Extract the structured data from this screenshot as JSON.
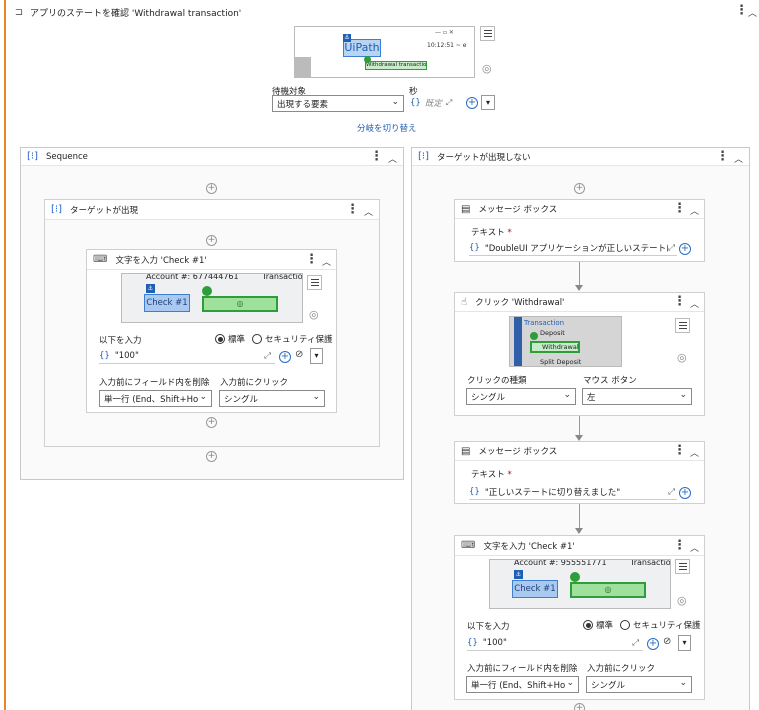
{
  "main": {
    "title": "アプリのステートを確認 'Withdrawal transaction'",
    "wait_label": "待機対象",
    "wait_value": "出現する要素",
    "seconds_label": "秒",
    "seconds_placeholder": "既定",
    "switch_link": "分岐を切り替え",
    "preview": {
      "brand": "UiPath",
      "time": "10:12:51 ~ e",
      "tag": "Withdrawal transaction",
      "win_controls": "—   ▫   ✕"
    }
  },
  "left": {
    "title": "Sequence",
    "inner_title": "ターゲットが出現",
    "type": {
      "title": "文字を入力 'Check #1'",
      "preview_account": "Account #: 677444761",
      "preview_trans": "Transactio",
      "preview_check": "Check #1",
      "input_label": "以下を入力",
      "radio_standard": "標準",
      "radio_secure": "セキュリティ保護",
      "value": "\"100\"",
      "clear_label": "入力前にフィールド内を削除",
      "clear_value": "単一行 (End、Shift+Hom",
      "click_label": "入力前にクリック",
      "click_value": "シングル"
    }
  },
  "right": {
    "title": "ターゲットが出現しない",
    "msg1": {
      "title": "メッセージ ボックス",
      "text_label": "テキスト",
      "value": "\"DoubleUI アプリケーションが正しいステートにあり"
    },
    "click": {
      "title": "クリック 'Withdrawal'",
      "preview_title": "Transaction",
      "preview_deposit": "Deposit",
      "preview_withdrawal": "Withdrawal",
      "preview_split": "Split Deposit",
      "type_label": "クリックの種類",
      "type_value": "シングル",
      "button_label": "マウス ボタン",
      "button_value": "左"
    },
    "msg2": {
      "title": "メッセージ ボックス",
      "text_label": "テキスト",
      "value": "\"正しいステートに切り替えました\""
    },
    "type": {
      "title": "文字を入力 'Check #1'",
      "preview_account": "Account #: 955551771",
      "preview_trans": "Transactio",
      "preview_check": "Check #1",
      "input_label": "以下を入力",
      "radio_standard": "標準",
      "radio_secure": "セキュリティ保護",
      "value": "\"100\"",
      "clear_label": "入力前にフィールド内を削除",
      "clear_value": "単一行 (End、Shift+Hom",
      "click_label": "入力前にクリック",
      "click_value": "シングル"
    }
  },
  "icons": {
    "plus": "+",
    "menu": "⋮",
    "chevron_up": "︿",
    "chevron_down": "⌄",
    "expand": "⤢",
    "dropdown": "▾",
    "brace": "{}",
    "required": "*",
    "anchor": "⚓",
    "target": "◎"
  },
  "colors": {
    "accent_blue": "#1f5fb4",
    "accent_orange": "#e8862a",
    "target_green": "#2e9e3a"
  }
}
